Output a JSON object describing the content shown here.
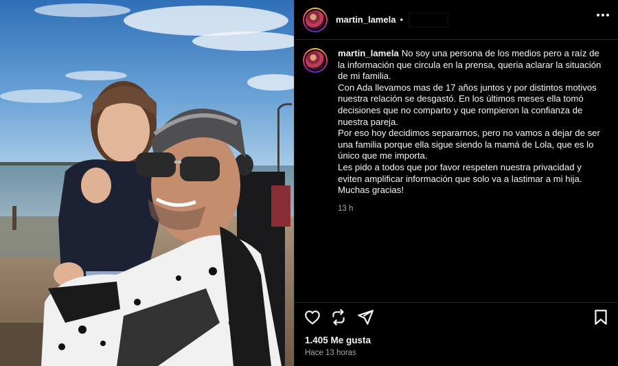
{
  "post": {
    "username": "martin_lamela",
    "separator": "•",
    "more_icon": "more-horizontal-icon",
    "caption": {
      "username": "martin_lamela",
      "lines": [
        "No soy una persona de los medios pero a raíz de la información que circula en la prensa, queria aclarar la situación de mi familia.",
        "Con Ada llevamos mas de 17 años juntos y por distintos motivos nuestra relación se desgastó. En los últimos meses ella tomó decisiones que no comparto y que rompieron la confianza de nuestra pareja.",
        "Por eso hoy decidimos separarnos, pero no vamos a dejar de ser una familia porque ella sigue siendo la mamá de Lola, que es lo único que me importa.",
        "Les pido a todos que por favor respeten nuestra privacidad y eviten amplificar información que solo va a lastimar a mi hija.",
        "Muchas gracias!"
      ],
      "time_ago": "13 h"
    },
    "actions": {
      "icons": [
        "heart-icon",
        "repost-icon",
        "share-icon",
        "bookmark-icon"
      ]
    },
    "likes": "1.405 Me gusta",
    "posted": "Hace 13 horas"
  }
}
